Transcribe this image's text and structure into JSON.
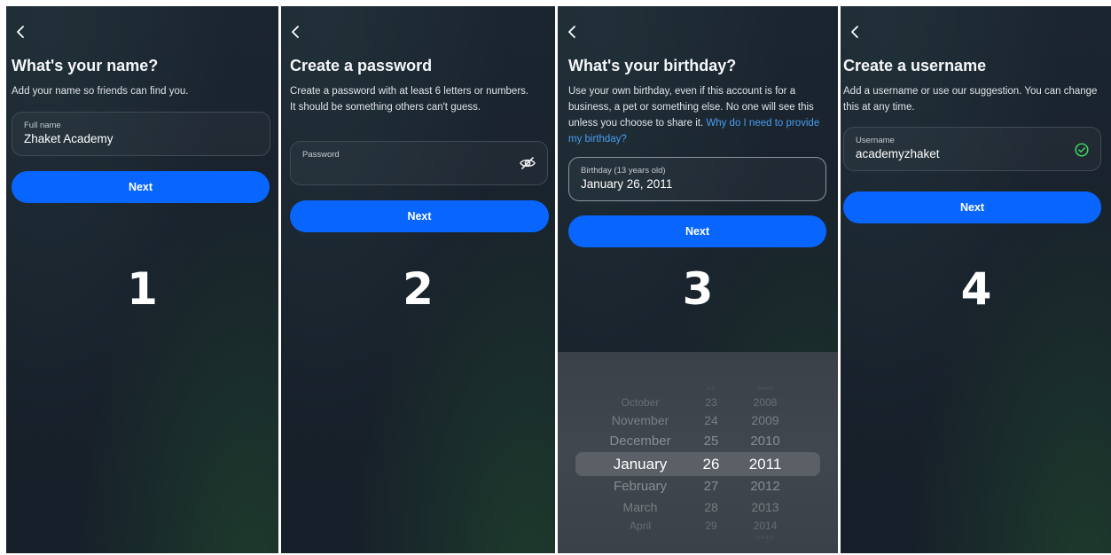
{
  "colors": {
    "accent": "#0866ff",
    "background": "#18212b",
    "link": "#4a9df0",
    "success": "#3fcf62"
  },
  "icons": {
    "back": "chevron-left-icon",
    "password_toggle": "eye-slash-icon",
    "username_valid": "check-circle-icon"
  },
  "screens": [
    {
      "step": "1",
      "title": "What's your name?",
      "subtitle": "Add your name so friends can find you.",
      "field_label": "Full name",
      "field_value": "Zhaket Academy",
      "button": "Next"
    },
    {
      "step": "2",
      "title": "Create a password",
      "subtitle": "Create a password with at least 6 letters or numbers. It should be something others can't guess.",
      "field_label": "Password",
      "field_value": "",
      "button": "Next"
    },
    {
      "step": "3",
      "title": "What's your birthday?",
      "subtitle": "Use your own birthday, even if this account is for a business, a pet or something else. No one will see this unless you choose to share it.",
      "subtitle_link": "Why do I need to provide my birthday?",
      "field_label": "Birthday (13 years old)",
      "field_value": "January 26, 2011",
      "button": "Next",
      "picker": {
        "months": [
          "",
          "October",
          "November",
          "December",
          "January",
          "February",
          "March",
          "April",
          ""
        ],
        "days": [
          "22",
          "23",
          "24",
          "25",
          "26",
          "27",
          "28",
          "29",
          ""
        ],
        "years": [
          "2007",
          "2008",
          "2009",
          "2010",
          "2011",
          "2012",
          "2013",
          "2014",
          "2015"
        ]
      }
    },
    {
      "step": "4",
      "title": "Create a username",
      "subtitle": "Add a username or use our suggestion. You can change this at any time.",
      "field_label": "Username",
      "field_value": "academyzhaket",
      "button": "Next"
    }
  ]
}
